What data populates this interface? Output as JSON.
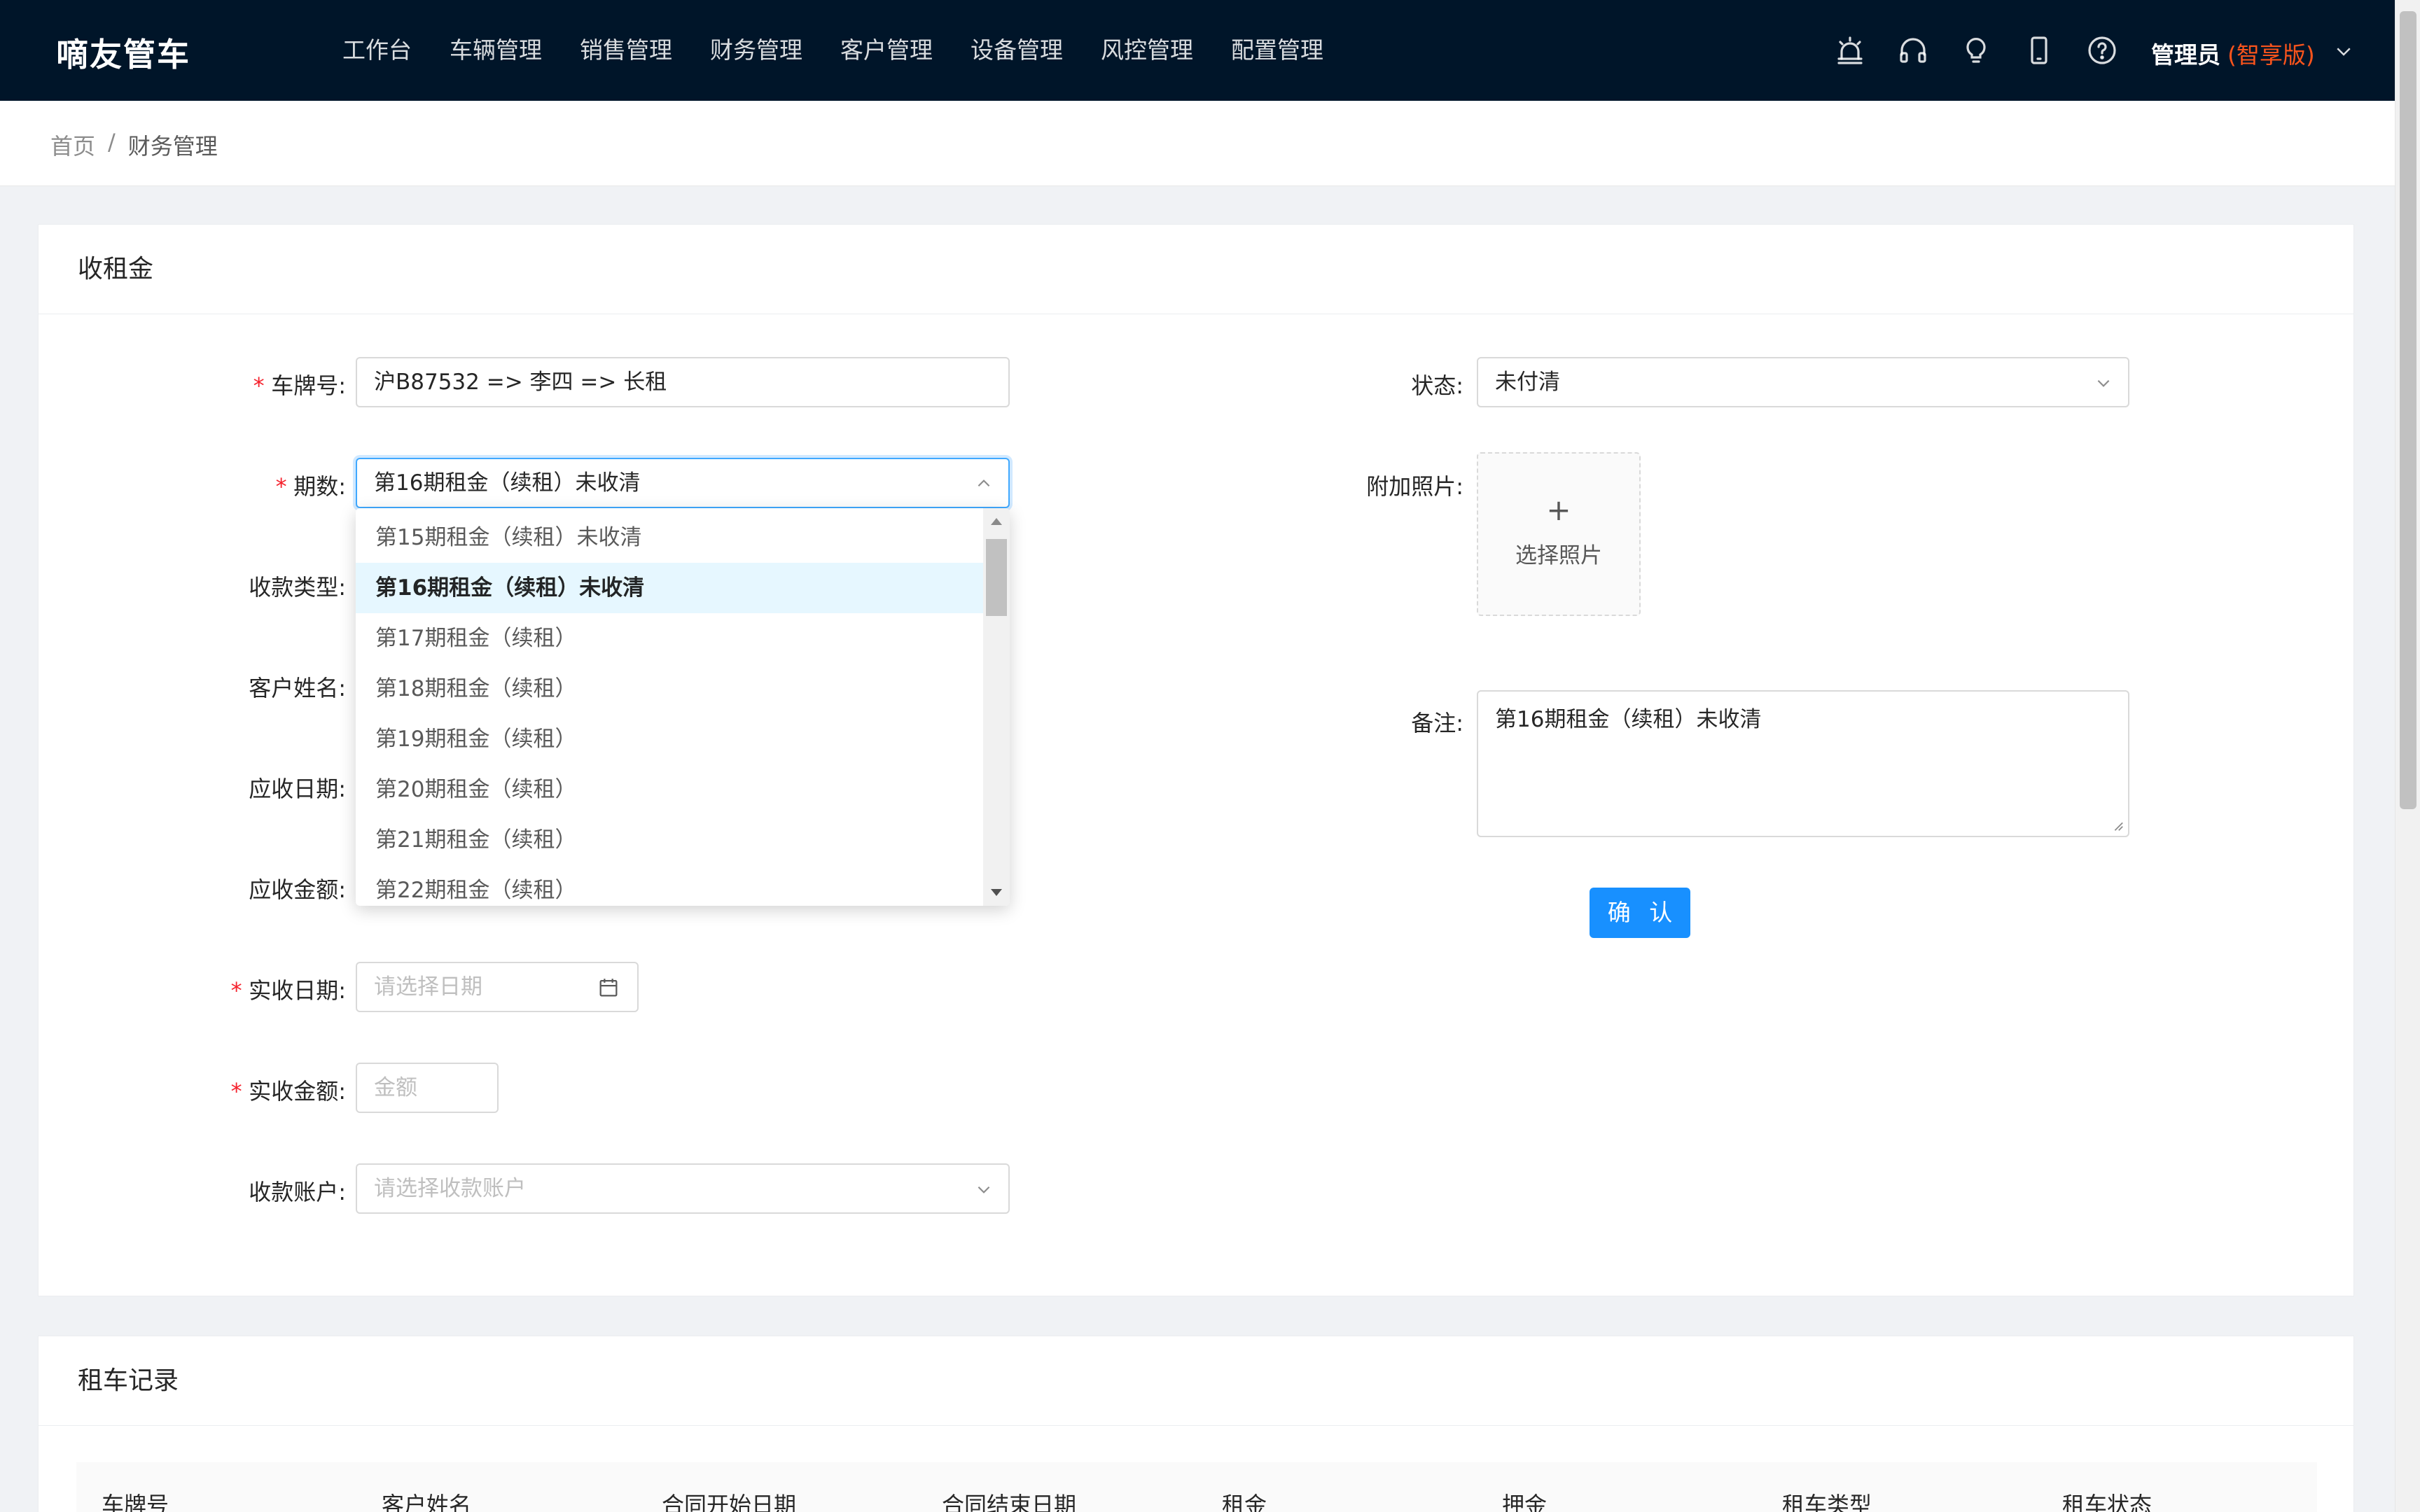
{
  "app": {
    "logo": "嘀友管车",
    "nav": [
      "工作台",
      "车辆管理",
      "销售管理",
      "财务管理",
      "客户管理",
      "设备管理",
      "风控管理",
      "配置管理"
    ],
    "tools": [
      "alarm-icon",
      "headset-icon",
      "bulb-icon",
      "mobile-icon",
      "help-icon"
    ],
    "user": "管理员",
    "edition": "(智享版)"
  },
  "breadcrumb": {
    "home": "首页",
    "sep": "/",
    "current": "财务管理"
  },
  "form_card": {
    "title": "收租金",
    "plate": {
      "label": "车牌号:",
      "value": "沪B87532 => 李四 => 长租"
    },
    "period": {
      "label": "期数:",
      "value": "第16期租金（续租）未收清"
    },
    "pay_type": {
      "label": "收款类型:"
    },
    "customer": {
      "label": "客户姓名:"
    },
    "due_date": {
      "label": "应收日期:"
    },
    "due_amount": {
      "label": "应收金额:"
    },
    "actual_date": {
      "label": "实收日期:",
      "placeholder": "请选择日期"
    },
    "actual_amount": {
      "label": "实收金额:",
      "placeholder": "金额"
    },
    "account": {
      "label": "收款账户:",
      "placeholder": "请选择收款账户"
    },
    "status": {
      "label": "状态:",
      "value": "未付清"
    },
    "photo": {
      "label": "附加照片:",
      "plus": "+",
      "text": "选择照片"
    },
    "remark": {
      "label": "备注:",
      "value": "第16期租金（续租）未收清"
    },
    "confirm": "确 认"
  },
  "period_dropdown": {
    "options": [
      "第15期租金（续租）未收清",
      "第16期租金（续租）未收清",
      "第17期租金（续租）",
      "第18期租金（续租）",
      "第19期租金（续租）",
      "第20期租金（续租）",
      "第21期租金（续租）",
      "第22期租金（续租）"
    ],
    "selected_index": 1
  },
  "records_card": {
    "title": "租车记录",
    "columns": [
      "车牌号",
      "客户姓名",
      "合同开始日期",
      "合同结束日期",
      "租金",
      "押金",
      "租车类型",
      "租车状态"
    ]
  },
  "colors": {
    "nav_bg": "#001529",
    "primary": "#1890ff",
    "required": "#f5222d",
    "edition": "#fa541c"
  }
}
